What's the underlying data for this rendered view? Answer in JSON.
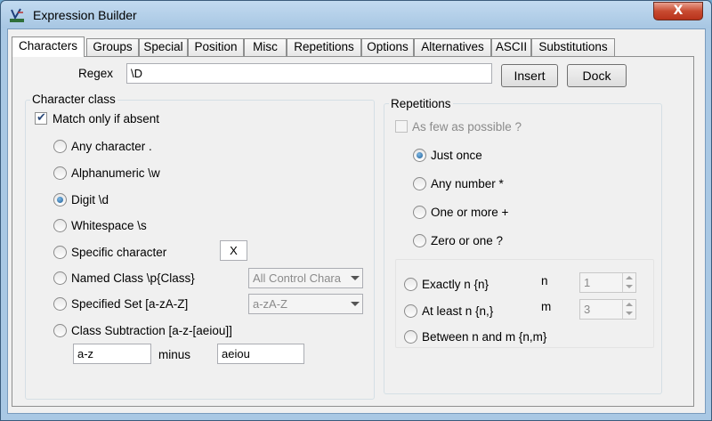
{
  "window": {
    "title": "Expression Builder",
    "close_label": "X"
  },
  "tabs": [
    "Characters",
    "Groups",
    "Special",
    "Position",
    "Misc",
    "Repetitions",
    "Options",
    "Alternatives",
    "ASCII",
    "Substitutions"
  ],
  "active_tab": "Characters",
  "regex": {
    "label": "Regex",
    "value": "\\D",
    "insert_label": "Insert",
    "dock_label": "Dock"
  },
  "character_class": {
    "title": "Character class",
    "match_absent_label": "Match only if absent",
    "match_absent_checked": true,
    "options": [
      {
        "label": "Any character .",
        "checked": false
      },
      {
        "label": "Alphanumeric \\w",
        "checked": false
      },
      {
        "label": "Digit \\d",
        "checked": true
      },
      {
        "label": "Whitespace \\s",
        "checked": false
      },
      {
        "label": "Specific character",
        "checked": false
      },
      {
        "label": "Named Class \\p{Class}",
        "checked": false
      },
      {
        "label": "Specified Set [a-zA-Z]",
        "checked": false
      },
      {
        "label": "Class Subtraction [a-z-[aeiou]]",
        "checked": false
      }
    ],
    "specific_char_value": "X",
    "named_class_value": "All Control Chara",
    "specified_set_value": "a-zA-Z",
    "subtraction_from": "a-z",
    "minus_label": "minus",
    "subtraction_minus": "aeiou"
  },
  "repetitions": {
    "title": "Repetitions",
    "few_as_possible_label": "As few as possible ?",
    "few_as_possible_checked": false,
    "options": [
      {
        "label": "Just once",
        "checked": true
      },
      {
        "label": "Any number *",
        "checked": false
      },
      {
        "label": "One or more +",
        "checked": false
      },
      {
        "label": "Zero or one ?",
        "checked": false
      }
    ],
    "exact_options": [
      {
        "label": "Exactly n {n}",
        "checked": false
      },
      {
        "label": "At least n {n,}",
        "checked": false
      },
      {
        "label": "Between n and m {n,m}",
        "checked": false
      }
    ],
    "n_label": "n",
    "n_value": "1",
    "m_label": "m",
    "m_value": "3"
  }
}
